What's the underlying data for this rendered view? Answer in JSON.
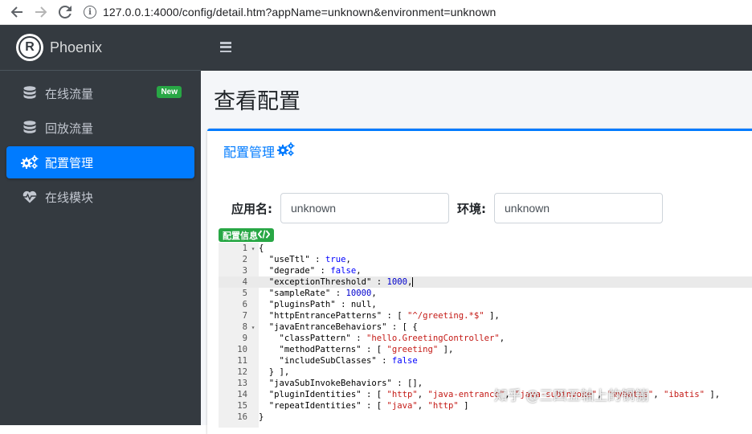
{
  "browser": {
    "url": "127.0.0.1:4000/config/detail.htm?appName=unknown&environment=unknown"
  },
  "sidebar": {
    "brand": "Phoenix",
    "brand_logo_letter": "R",
    "items": [
      {
        "label": "在线流量",
        "icon": "database-icon",
        "badge": "New",
        "active": false
      },
      {
        "label": "回放流量",
        "icon": "database-icon",
        "active": false
      },
      {
        "label": "配置管理",
        "icon": "gears-icon",
        "active": true
      },
      {
        "label": "在线模块",
        "icon": "heartbeat-icon",
        "active": false
      }
    ]
  },
  "page": {
    "title": "查看配置",
    "card_title": "配置管理",
    "app_label": "应用名:",
    "app_value": "unknown",
    "env_label": "环境:",
    "env_value": "unknown",
    "config_badge": "配置信息"
  },
  "code": {
    "lines": [
      {
        "n": "1",
        "fold": "▾",
        "text": "{"
      },
      {
        "n": "2",
        "fold": "",
        "text": "  \"useTtl\" : true,"
      },
      {
        "n": "3",
        "fold": "",
        "text": "  \"degrade\" : false,"
      },
      {
        "n": "4",
        "fold": "",
        "text": "  \"exceptionThreshold\" : 1000,"
      },
      {
        "n": "5",
        "fold": "",
        "text": "  \"sampleRate\" : 10000,"
      },
      {
        "n": "6",
        "fold": "",
        "text": "  \"pluginsPath\" : null,"
      },
      {
        "n": "7",
        "fold": "",
        "text": "  \"httpEntrancePatterns\" : [ \"^/greeting.*$\" ],"
      },
      {
        "n": "8",
        "fold": "▾",
        "text": "  \"javaEntranceBehaviors\" : [ {"
      },
      {
        "n": "9",
        "fold": "",
        "text": "    \"classPattern\" : \"hello.GreetingController\","
      },
      {
        "n": "10",
        "fold": "",
        "text": "    \"methodPatterns\" : [ \"greeting\" ],"
      },
      {
        "n": "11",
        "fold": "",
        "text": "    \"includeSubClasses\" : false"
      },
      {
        "n": "12",
        "fold": "",
        "text": "  } ],"
      },
      {
        "n": "13",
        "fold": "",
        "text": "  \"javaSubInvokeBehaviors\" : [],"
      },
      {
        "n": "14",
        "fold": "",
        "text": "  \"pluginIdentities\" : [ \"http\", \"java-entrance\", \"java-subinvoke\", \"mybatis\", \"ibatis\" ],"
      },
      {
        "n": "15",
        "fold": "",
        "text": "  \"repeatIdentities\" : [ \"java\", \"http\" ]"
      },
      {
        "n": "16",
        "fold": "",
        "text": "}"
      }
    ],
    "active_line": 4
  },
  "watermark": "知乎 @三四五轴上的钢镚",
  "colors": {
    "sidebar_bg": "#343a40",
    "accent": "#007bff",
    "badge_green": "#28a745"
  }
}
